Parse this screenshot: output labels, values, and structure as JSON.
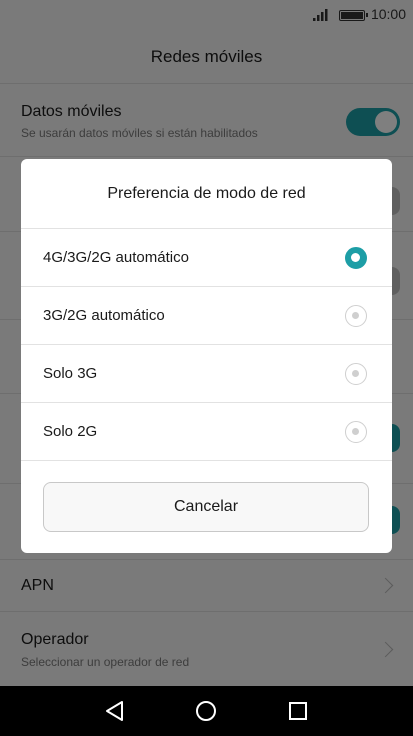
{
  "status_bar": {
    "time": "10:00",
    "signal_icon": "signal-icon",
    "battery_icon": "battery-icon"
  },
  "page": {
    "title": "Redes móviles"
  },
  "settings": {
    "datos_moviles": {
      "title": "Datos móviles",
      "subtitle": "Se usarán datos móviles si están habilitados",
      "enabled": true
    },
    "apn": {
      "title": "APN"
    },
    "operador": {
      "title": "Operador",
      "subtitle": "Seleccionar un operador de red"
    }
  },
  "dialog": {
    "title": "Preferencia de modo de red",
    "options": [
      {
        "label": "4G/3G/2G automático",
        "selected": true
      },
      {
        "label": "3G/2G automático",
        "selected": false
      },
      {
        "label": "Solo 3G",
        "selected": false
      },
      {
        "label": "Solo 2G",
        "selected": false
      }
    ],
    "cancel_label": "Cancelar"
  },
  "accent_color": "#1d9ea6",
  "nav_bar": {
    "icons": [
      "back-icon",
      "home-icon",
      "recents-icon"
    ]
  }
}
